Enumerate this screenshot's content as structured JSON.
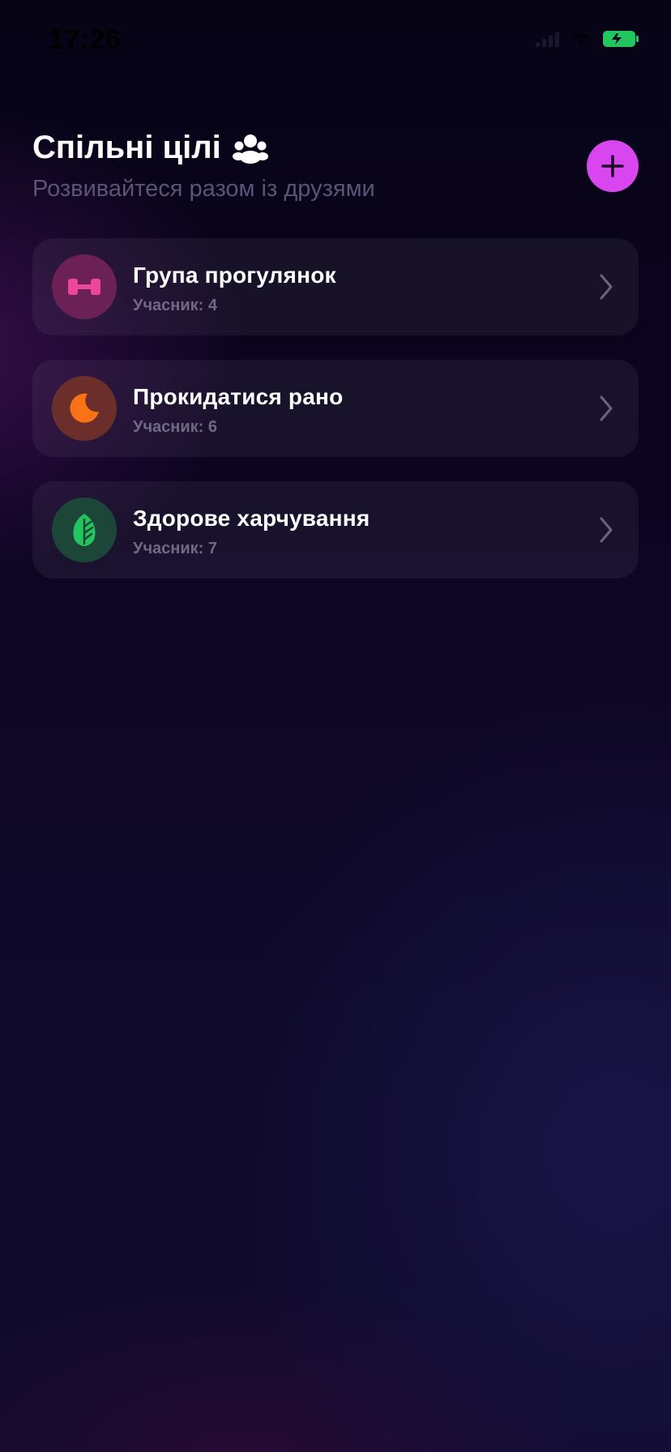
{
  "status_bar": {
    "time": "17:26"
  },
  "header": {
    "title": "Спільні цілі",
    "title_icon": "people-icon",
    "subtitle": "Розвивайтеся разом із друзями",
    "add_button_icon": "plus-icon"
  },
  "groups": [
    {
      "name": "Група прогулянок",
      "members": "Учасник: 4",
      "icon": "dumbbell-icon",
      "icon_color": "#ec4899",
      "avatar_bg": "#6b2155"
    },
    {
      "name": "Прокидатися рано",
      "members": "Учасник: 6",
      "icon": "moon-icon",
      "icon_color": "#f97316",
      "avatar_bg": "#6b2e2a"
    },
    {
      "name": "Здорове харчування",
      "members": "Учасник: 7",
      "icon": "leaf-icon",
      "icon_color": "#22c55e",
      "avatar_bg": "#1c4638"
    }
  ],
  "colors": {
    "accent": "#d946ef",
    "battery": "#22c55e"
  }
}
